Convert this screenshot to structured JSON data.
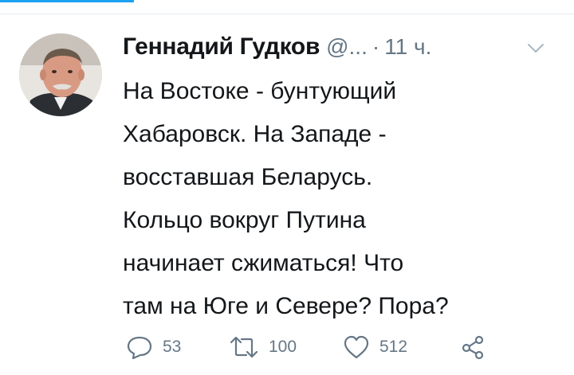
{
  "tweet": {
    "author": {
      "display_name": "Геннадий Гудков",
      "handle": "@...",
      "avatar_icon": "user-portrait-photo"
    },
    "separator": "·",
    "time": "11 ч.",
    "menu_icon": "chevron-down-icon",
    "text_lines": [
      "На Востоке - бунтующий",
      "Хабаровск. На Западе -",
      "восставшая Беларусь.",
      "Кольцо вокруг Путина",
      "начинает сжиматься! Что",
      "там на Юге и Севере? Пора?"
    ],
    "actions": {
      "reply": {
        "icon": "reply-icon",
        "count": "53"
      },
      "retweet": {
        "icon": "retweet-icon",
        "count": "100"
      },
      "like": {
        "icon": "heart-icon",
        "count": "512"
      },
      "share": {
        "icon": "share-icon"
      }
    }
  },
  "colors": {
    "text_primary": "#14171a",
    "text_secondary": "#657786",
    "accent": "#1da1f2"
  }
}
